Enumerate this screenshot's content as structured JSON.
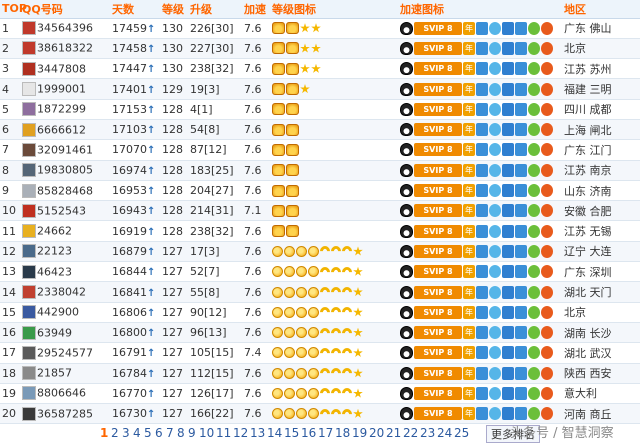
{
  "headers": {
    "rank": "TOP",
    "qq": "QQ号码",
    "days": "天数",
    "level": "等级",
    "upgrade": "升级",
    "speed": "加速",
    "level_icon": "等级图标",
    "speed_icon": "加速图标",
    "region": "地区"
  },
  "colors": {
    "header_text": "#ff6600",
    "header_bg": "#edf4fb",
    "arrow": "#2c6fb7",
    "current_page": "#ff6600"
  },
  "svip_label": "SVIP 8",
  "nian_label": "年",
  "rows": [
    {
      "rank": "1",
      "qq": "34564396",
      "days": "17459",
      "level": "130",
      "upgrade": "226[30]",
      "speed": "7.6",
      "lv": "CCSS",
      "region": "广东 佛山",
      "ext": "",
      "av": "#c0392b"
    },
    {
      "rank": "2",
      "qq": "38618322",
      "days": "17458",
      "level": "130",
      "upgrade": "227[30]",
      "speed": "7.6",
      "lv": "CCSS",
      "region": "北京",
      "ext": "",
      "av": "#c0392b"
    },
    {
      "rank": "3",
      "qq": "3447808",
      "days": "17447",
      "level": "130",
      "upgrade": "238[32]",
      "speed": "7.6",
      "lv": "CCSS",
      "region": "江苏 苏州",
      "ext": "",
      "av": "#b03020"
    },
    {
      "rank": "4",
      "qq": "1999001",
      "days": "17401",
      "level": "129",
      "upgrade": "19[3]",
      "speed": "7.6",
      "lv": "CCS",
      "region": "福建 三明",
      "ext": "",
      "av": "#e6e6e6"
    },
    {
      "rank": "5",
      "qq": "1872299",
      "days": "17153",
      "level": "128",
      "upgrade": "4[1]",
      "speed": "7.6",
      "lv": "CC",
      "region": "四川 成都",
      "ext": "",
      "av": "#8e6e9e"
    },
    {
      "rank": "6",
      "qq": "6666612",
      "days": "17103",
      "level": "128",
      "upgrade": "54[8]",
      "speed": "7.6",
      "lv": "CC",
      "region": "上海 闸北",
      "ext": "",
      "av": "#e0a020"
    },
    {
      "rank": "7",
      "qq": "32091461",
      "days": "17070",
      "level": "128",
      "upgrade": "87[12]",
      "speed": "7.6",
      "lv": "CC",
      "region": "广东 江门",
      "ext": "",
      "av": "#6a4a3a"
    },
    {
      "rank": "8",
      "qq": "19830805",
      "days": "16974",
      "level": "128",
      "upgrade": "183[25]",
      "speed": "7.6",
      "lv": "CC",
      "region": "江苏 南京",
      "ext": "",
      "av": "#556677"
    },
    {
      "rank": "9",
      "qq": "85828468",
      "days": "16953",
      "level": "128",
      "upgrade": "204[27]",
      "speed": "7.6",
      "lv": "CC",
      "region": "山东 济南",
      "ext": "",
      "av": "#aab0b8"
    },
    {
      "rank": "10",
      "qq": "5152543",
      "days": "16943",
      "level": "128",
      "upgrade": "214[31]",
      "speed": "7.1",
      "lv": "CC",
      "region": "安徽 合肥",
      "ext": "",
      "av": "#c03020"
    },
    {
      "rank": "11",
      "qq": "24662",
      "days": "16919",
      "level": "128",
      "upgrade": "238[32]",
      "speed": "7.6",
      "lv": "CC",
      "region": "江苏 无锡",
      "ext": "",
      "av": "#e8b020"
    },
    {
      "rank": "12",
      "qq": "22123",
      "days": "16879",
      "level": "127",
      "upgrade": "17[3]",
      "speed": "7.6",
      "lv": "UUUUMMMS",
      "region": "辽宁 大连",
      "ext": "",
      "av": "#4a6a8a"
    },
    {
      "rank": "13",
      "qq": "46423",
      "days": "16844",
      "level": "127",
      "upgrade": "52[7]",
      "speed": "7.6",
      "lv": "UUUUMMMS",
      "region": "广东 深圳",
      "ext": "",
      "av": "#2a3a4a"
    },
    {
      "rank": "14",
      "qq": "2338042",
      "days": "16841",
      "level": "127",
      "upgrade": "55[8]",
      "speed": "7.6",
      "lv": "UUUUMMMS",
      "region": "湖北 天门",
      "ext": "",
      "av": "#c04030"
    },
    {
      "rank": "15",
      "qq": "442900",
      "days": "16806",
      "level": "127",
      "upgrade": "90[12]",
      "speed": "7.6",
      "lv": "UUUUMMMS",
      "region": "北京",
      "ext": "",
      "av": "#3a5aa0"
    },
    {
      "rank": "16",
      "qq": "63949",
      "days": "16800",
      "level": "127",
      "upgrade": "96[13]",
      "speed": "7.6",
      "lv": "UUUUMMMS",
      "region": "湖南 长沙",
      "ext": "",
      "av": "#3a9a4a"
    },
    {
      "rank": "17",
      "qq": "29524577",
      "days": "16791",
      "level": "127",
      "upgrade": "105[15]",
      "speed": "7.4",
      "lv": "UUUUMMMS",
      "region": "湖北 武汉",
      "ext": "",
      "av": "#5a5a5a"
    },
    {
      "rank": "18",
      "qq": "21857",
      "days": "16784",
      "level": "127",
      "upgrade": "112[15]",
      "speed": "7.6",
      "lv": "UUUUMMMS",
      "region": "陕西 西安",
      "ext": "",
      "av": "#8a8a8a"
    },
    {
      "rank": "19",
      "qq": "8806646",
      "days": "16770",
      "level": "127",
      "upgrade": "126[17]",
      "speed": "7.6",
      "lv": "UUUUMMMS",
      "region": "意大利",
      "ext": "",
      "av": "#7a9ab8"
    },
    {
      "rank": "20",
      "qq": "36587285",
      "days": "16730",
      "level": "127",
      "upgrade": "166[22]",
      "speed": "7.6",
      "lv": "UUUUMMMS",
      "region": "河南 商丘",
      "ext": "",
      "av": "#3a3a3a"
    }
  ],
  "pager": {
    "pages": [
      "1",
      "2",
      "3",
      "4",
      "5",
      "6",
      "7",
      "8",
      "9",
      "10",
      "11",
      "12",
      "13",
      "14",
      "15",
      "16",
      "17",
      "18",
      "19",
      "20",
      "21",
      "22",
      "23",
      "24",
      "25"
    ],
    "current": "1",
    "more_label": "更多排名"
  },
  "watermark": "头条号 / 智慧洞察"
}
